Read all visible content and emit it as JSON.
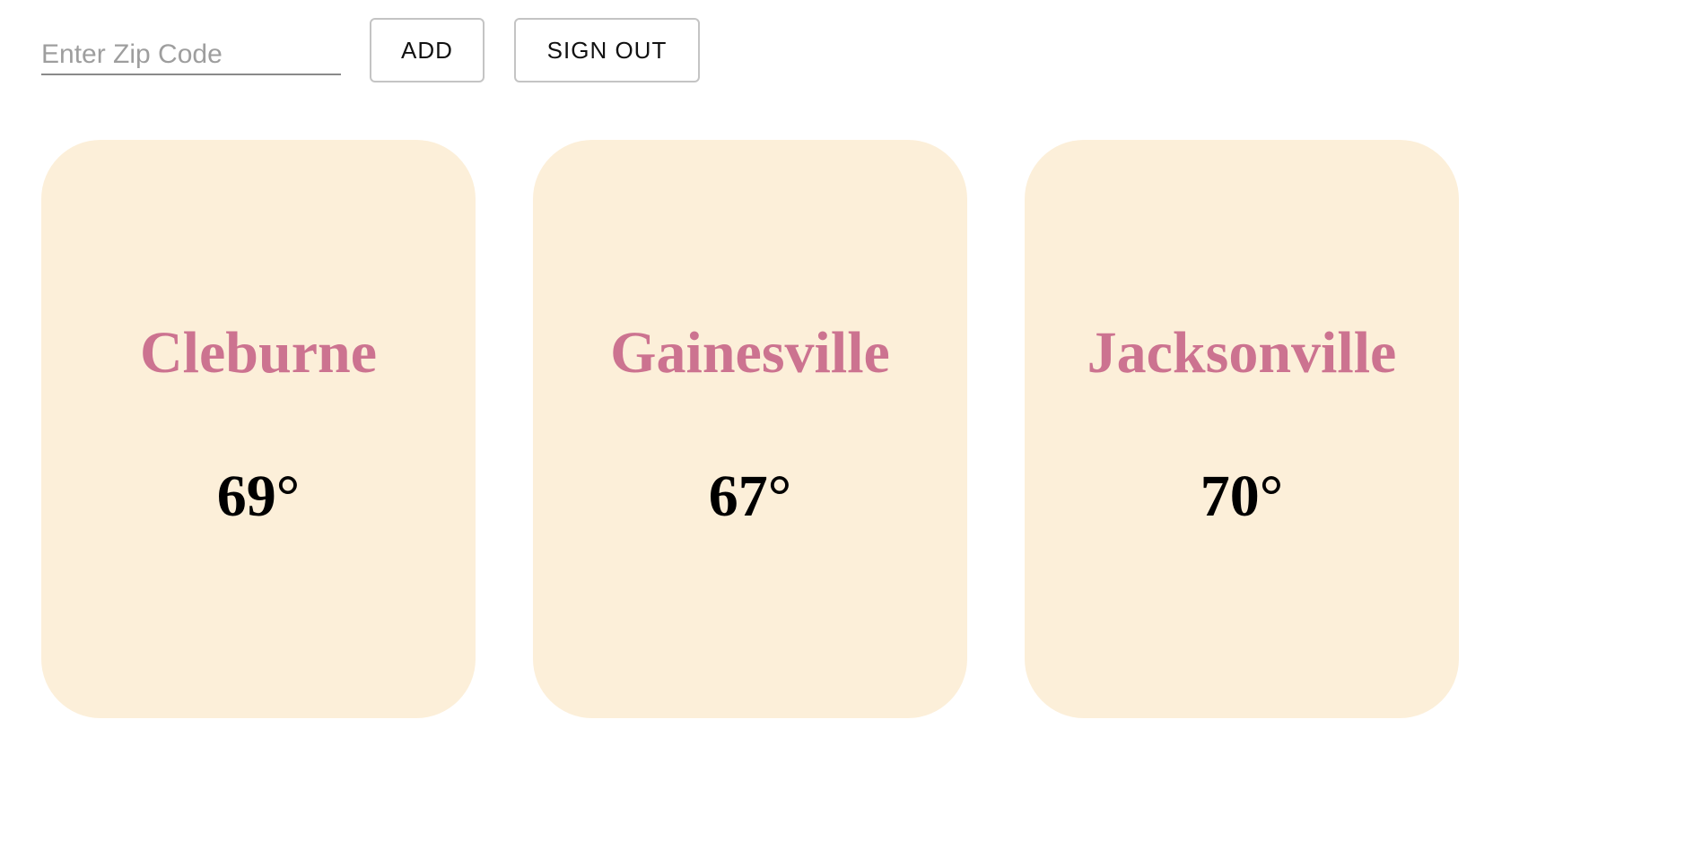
{
  "search": {
    "zip_placeholder": "Enter Zip Code",
    "zip_value": "",
    "add_label": "ADD",
    "signout_label": "SIGN OUT"
  },
  "cities": [
    {
      "name": "Cleburne",
      "temperature": "69°"
    },
    {
      "name": "Gainesville",
      "temperature": "67°"
    },
    {
      "name": "Jacksonville",
      "temperature": "70°"
    }
  ],
  "colors": {
    "card_background": "#fcefd9",
    "city_name": "#cc7390",
    "temperature": "#000000",
    "button_border": "#c4c4c4",
    "input_underline": "#8a8a8a",
    "placeholder": "#9e9e9e"
  }
}
